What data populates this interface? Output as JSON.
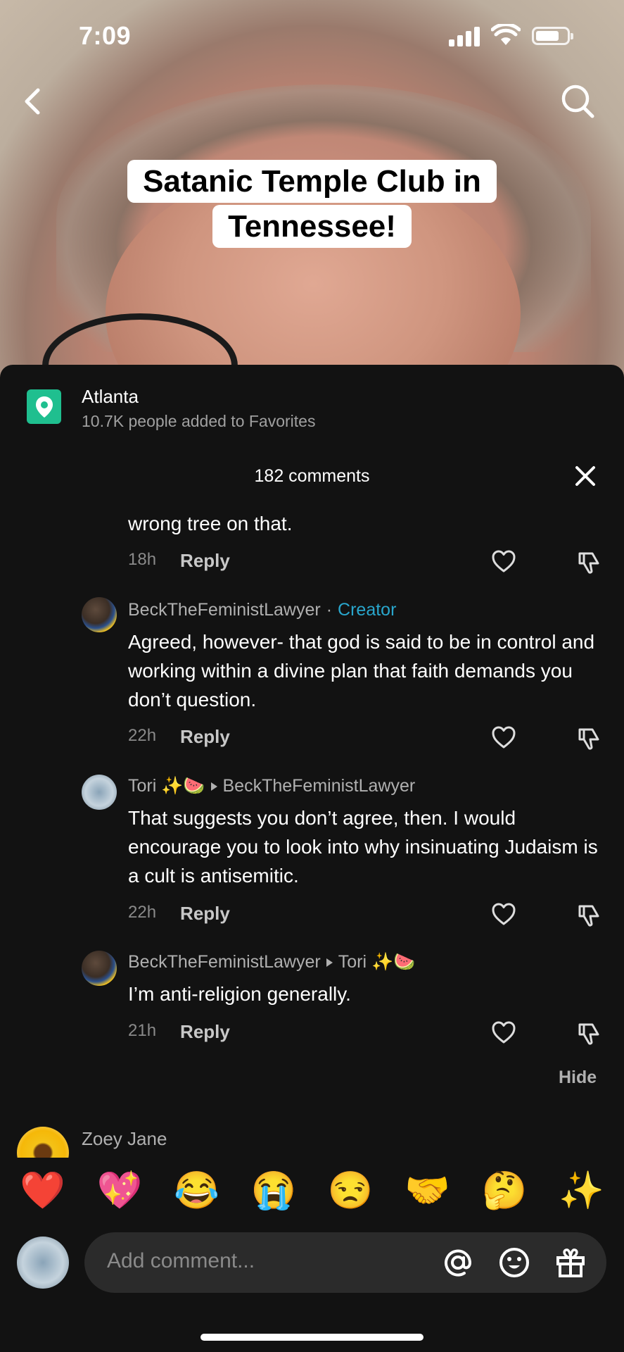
{
  "status_bar": {
    "time": "7:09"
  },
  "video": {
    "caption_line1": "Satanic Temple Club in",
    "caption_line2": "Tennessee!"
  },
  "location": {
    "title": "Atlanta",
    "subtitle": "10.7K people added to Favorites"
  },
  "comments_header": {
    "count_label": "182 comments"
  },
  "comments": [
    {
      "text": "wrong tree on that.",
      "time": "18h",
      "reply_label": "Reply"
    },
    {
      "user": "BeckTheFeministLawyer",
      "badge_sep": "·",
      "badge": "Creator",
      "text": "Agreed, however- that god is said to be in control and working within a divine plan that faith demands you don’t question.",
      "time": "22h",
      "reply_label": "Reply"
    },
    {
      "user": "Tori ✨🍉",
      "reply_to": "BeckTheFeministLawyer",
      "text": "That suggests you don’t agree, then. I would encourage you to look into why insinuating Judaism is a cult is antisemitic.",
      "time": "22h",
      "reply_label": "Reply"
    },
    {
      "user": "BeckTheFeministLawyer",
      "reply_to": "Tori ✨🍉",
      "text": "I’m anti-religion generally.",
      "time": "21h",
      "reply_label": "Reply"
    }
  ],
  "hide_label": "Hide",
  "next_comment": {
    "user": "Zoey Jane"
  },
  "emoji_bar": [
    "❤️",
    "💖",
    "😂",
    "😭",
    "😒",
    "🤝",
    "🤔",
    "✨"
  ],
  "input": {
    "placeholder": "Add comment..."
  },
  "icons": {
    "back": "back-chevron-icon",
    "search": "search-icon",
    "location": "location-pin-icon",
    "close": "close-icon",
    "like": "heart-icon",
    "dislike": "dislike-icon",
    "mention": "at-icon",
    "emoji": "emoji-face-icon",
    "gift": "gift-icon"
  },
  "colors": {
    "accent_creator": "#29a6cc",
    "location_icon_bg": "#1fbf8f",
    "sheet_bg": "#121212"
  }
}
